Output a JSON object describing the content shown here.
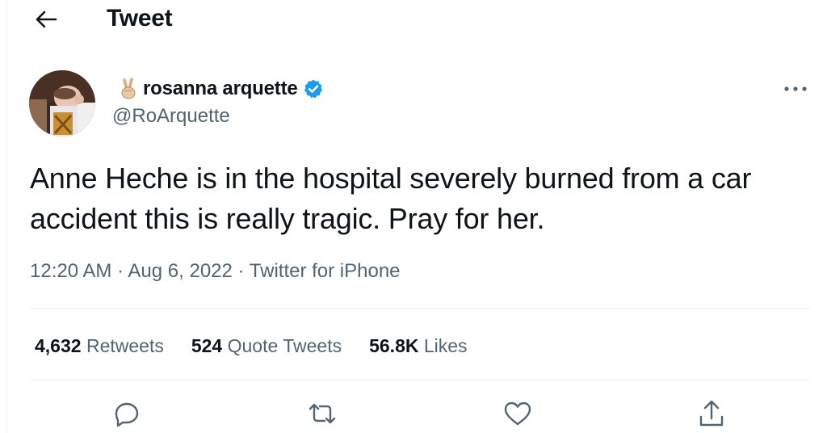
{
  "header": {
    "title": "Tweet",
    "back_icon": "arrow-left-icon"
  },
  "author": {
    "emoji": "✌🏼",
    "name": "rosanna arquette",
    "handle": "@RoArquette",
    "verified": true
  },
  "tweet": {
    "text": "Anne Heche is in the hospital severely burned from a car accident this is really tragic. Pray for her.",
    "time": "12:20 AM",
    "date": "Aug 6, 2022",
    "source": "Twitter for iPhone",
    "separator": "·"
  },
  "stats": {
    "retweets_count": "4,632",
    "retweets_label": "Retweets",
    "quotes_count": "524",
    "quotes_label": "Quote Tweets",
    "likes_count": "56.8K",
    "likes_label": "Likes"
  },
  "actions": [
    "reply-icon",
    "retweet-icon",
    "like-icon",
    "share-icon"
  ],
  "colors": {
    "text_primary": "#0f1419",
    "text_secondary": "#536471",
    "verified_blue": "#1d9bf0",
    "divider": "#eff3f4"
  }
}
